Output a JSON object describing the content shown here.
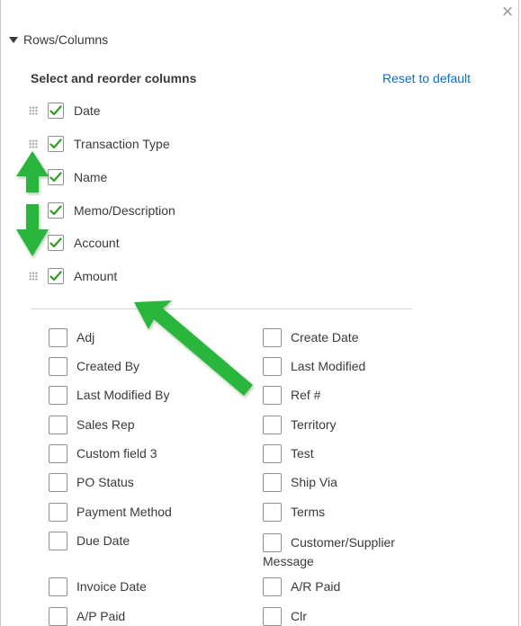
{
  "panel": {
    "close_glyph": "×",
    "section_title": "Rows/Columns",
    "select_label": "Select and reorder columns",
    "reset_label": "Reset to default"
  },
  "selected_columns": [
    {
      "label": "Date",
      "checked": true
    },
    {
      "label": "Transaction Type",
      "checked": true
    },
    {
      "label": "Name",
      "checked": true
    },
    {
      "label": "Memo/Description",
      "checked": true
    },
    {
      "label": "Account",
      "checked": true
    },
    {
      "label": "Amount",
      "checked": true
    }
  ],
  "available_columns": {
    "left": [
      "Adj",
      "Created By",
      "Last Modified By",
      "Sales Rep",
      "Custom field 3",
      "PO Status",
      "Payment Method",
      "Due Date",
      "Invoice Date",
      "A/P Paid"
    ],
    "right": [
      "Create Date",
      "Last Modified",
      "Ref #",
      "Territory",
      "Test",
      "Ship Via",
      "Terms",
      "Customer/Supplier",
      "A/R Paid",
      "Clr"
    ],
    "right_wrap": "Message"
  },
  "colors": {
    "check": "#2ca01c",
    "arrow": "#2bb53c",
    "link": "#0d6fc4"
  },
  "icons": {
    "close": "close-icon",
    "collapse": "triangle-down-icon",
    "grip": "drag-handle-icon",
    "check": "check-icon"
  }
}
